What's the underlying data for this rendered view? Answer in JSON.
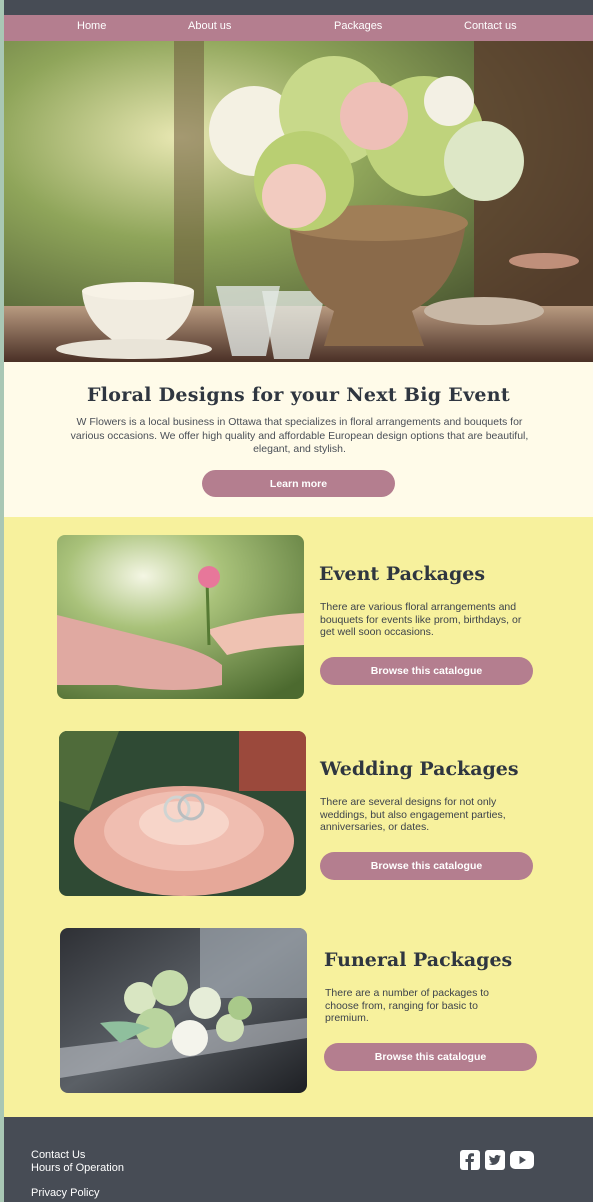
{
  "nav": {
    "items": [
      "Home",
      "About us",
      "Packages",
      "Contact us"
    ]
  },
  "intro": {
    "title": "Floral Designs for your Next Big Event",
    "text": "W Flowers is a local business in Ottawa that specializes in floral arrangements and bouquets for various occasions. We offer high quality and affordable European design options that are beautiful, elegant, and stylish.",
    "button": "Learn more"
  },
  "packages": [
    {
      "title": "Event Packages",
      "text": "There are various floral arrangements and bouquets for events like prom, birthdays, or get well soon occasions.",
      "button": "Browse this catalogue"
    },
    {
      "title": "Wedding Packages",
      "text": "There are several designs for not only weddings, but also engagement parties, anniversaries, or dates.",
      "button": "Browse this catalogue"
    },
    {
      "title": "Funeral Packages",
      "text": "There are a number of packages to choose from, ranging for basic to premium.",
      "button": "Browse this catalogue"
    }
  ],
  "footer": {
    "links": [
      "Contact Us",
      "Hours of Operation",
      "Privacy Policy"
    ],
    "social_icons": [
      "facebook-icon",
      "twitter-icon",
      "youtube-icon"
    ]
  },
  "colors": {
    "accent": "#b47e8f",
    "dark": "#474c55",
    "intro_bg": "#fffbe9",
    "main_bg": "#f7f19d"
  }
}
